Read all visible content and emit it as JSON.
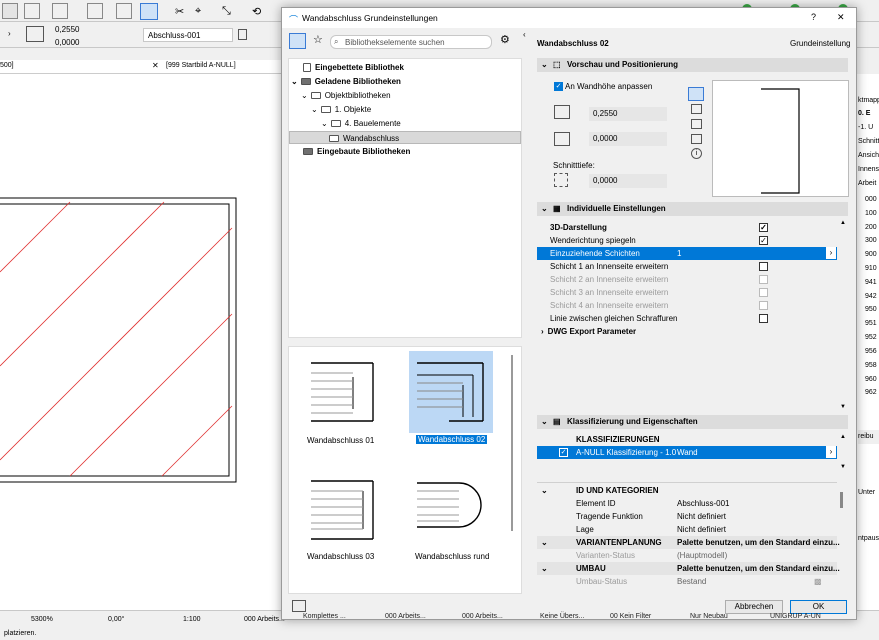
{
  "app": {
    "toolbar": {
      "height_value": "0,2550",
      "offset_value": "0,0000",
      "name_field": "Abschluss-001"
    },
    "tabs": {
      "left_tab": "500]",
      "right_tab": "[999 Startbild A-NULL]"
    },
    "statusbar": {
      "zoom": "5300%",
      "angle": "0,00°",
      "scale": "1:100",
      "layer": "000 Arbeits...",
      "items": [
        "Komplettes ...",
        "000 Arbeits...",
        "000 Arbeits...",
        "Keine Übers...",
        "00 Kein Filter",
        "Nur Neubau",
        "UNIGRUP A-UN"
      ],
      "status_text": "platzieren."
    },
    "right_panel": {
      "items": [
        "ktmapp",
        "0. E",
        "-1. U",
        "Schnitt",
        "Ansich",
        "Innens",
        "Arbeit",
        "000",
        "100",
        "200",
        "300",
        "900",
        "910",
        "941",
        "942",
        "950",
        "951",
        "952",
        "956",
        "958",
        "960",
        "962"
      ],
      "labels": [
        "reibu",
        "Unter",
        "ntpaus"
      ]
    }
  },
  "dialog": {
    "title": "Wandabschluss Grundeinstellungen",
    "help": "?",
    "close": "✕",
    "search_placeholder": "Bibliothekselemente suchen",
    "tree": [
      {
        "label": "Eingebettete Bibliothek",
        "bold": true
      },
      {
        "label": "Geladene Bibliotheken",
        "bold": true
      },
      {
        "label": "Objektbibliotheken"
      },
      {
        "label": "1. Objekte"
      },
      {
        "label": "4. Bauelemente"
      },
      {
        "label": "Wandabschluss"
      },
      {
        "label": "Eingebaute Bibliotheken",
        "bold": true
      }
    ],
    "thumbnails": [
      "Wandabschluss 01",
      "Wandabschluss 02",
      "Wandabschluss 03",
      "Wandabschluss rund"
    ],
    "header_title": "Wandabschluss 02",
    "header_right": "Grundeinstellung",
    "preview": {
      "section": "Vorschau und Positionierung",
      "fit_label": "An Wandhöhe anpassen",
      "height": "0,2550",
      "offset": "0,0000",
      "depth_label": "Schnitttiefe:",
      "depth": "0,0000"
    },
    "individual": {
      "section": "Individuelle Einstellungen",
      "rows": [
        {
          "label": "3D-Darstellung",
          "bold": true,
          "check": "✓"
        },
        {
          "label": "Wenderichtung spiegeln",
          "check": "✓"
        },
        {
          "label": "Einzuziehende Schichten",
          "value": "1",
          "selected": true
        },
        {
          "label": "Schicht 1 an Innenseite erweitern",
          "check": ""
        },
        {
          "label": "Schicht 2 an Innenseite erweitern",
          "disabled": true
        },
        {
          "label": "Schicht 3 an Innenseite erweitern",
          "disabled": true
        },
        {
          "label": "Schicht 4 an Innenseite erweitern",
          "disabled": true
        },
        {
          "label": "Linie zwischen gleichen Schraffuren",
          "check": ""
        }
      ],
      "dwg": "DWG Export Parameter"
    },
    "classification": {
      "section": "Klassifizierung und Eigenschaften",
      "header": "KLASSIFIZIERUNGEN",
      "row_label": "A-NULL Klassifizierung - 1.0",
      "row_value": "Wand"
    },
    "properties": [
      {
        "group": "ID UND KATEGORIEN"
      },
      {
        "label": "Element ID",
        "value": "Abschluss-001"
      },
      {
        "label": "Tragende Funktion",
        "value": "Nicht definiert"
      },
      {
        "label": "Lage",
        "value": "Nicht definiert"
      },
      {
        "group": "VARIANTENPLANUNG",
        "value": "Palette benutzen, um den Standard einzu..."
      },
      {
        "label": "Varianten-Status",
        "value": "(Hauptmodell)",
        "disabled": true
      },
      {
        "group": "UMBAU",
        "value": "Palette benutzen, um den Standard einzu..."
      },
      {
        "label": "Umbau-Status",
        "value": "Bestand",
        "disabled": true
      }
    ],
    "cancel": "Abbrechen",
    "ok": "OK"
  }
}
